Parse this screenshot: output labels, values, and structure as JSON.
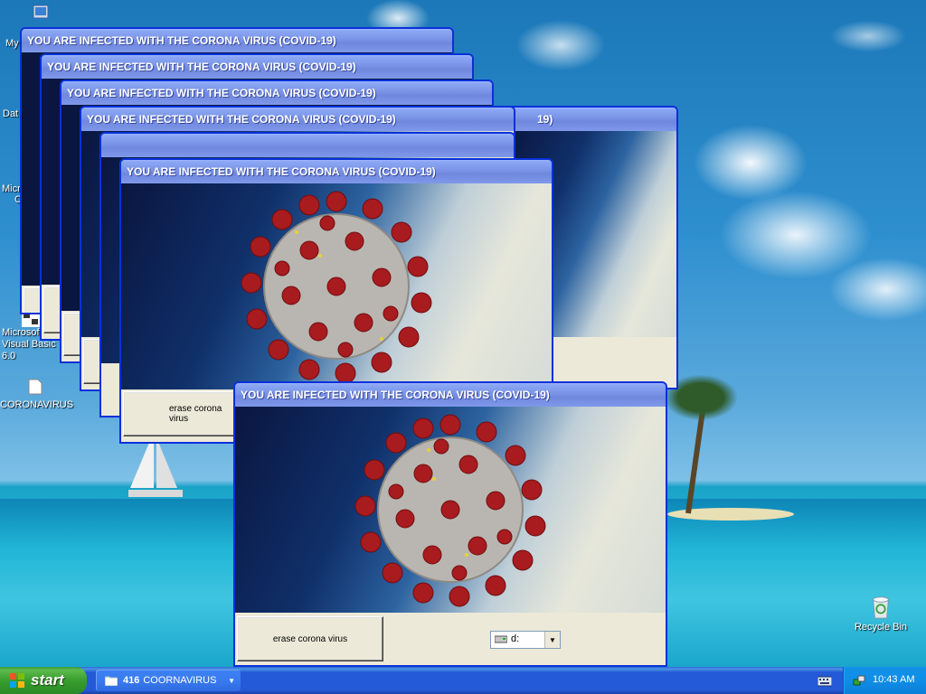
{
  "desktop": {
    "icons": [
      {
        "label": "My"
      },
      {
        "label": "Dat"
      },
      {
        "label": "Micros"
      },
      {
        "label": "C"
      },
      {
        "label": "Microsoft Visual Basic 6.0"
      },
      {
        "label": "CORONAVIRUS"
      },
      {
        "label": "Recycle Bin"
      }
    ]
  },
  "windows": {
    "title": "YOU ARE INFECTED WITH THE CORONA VIRUS (COVID-19)",
    "erase_button": "erase corona virus",
    "erase_button_partial": "e",
    "drive_value": "d:",
    "drive_icon": "drive-icon"
  },
  "taskbar": {
    "start_label": "start",
    "task_group_count": "416",
    "task_group_label": "COORNAVIRUS",
    "clock": "10:43 AM"
  },
  "colors": {
    "title_bar": "#7c96e8",
    "window_frame": "#0831d9",
    "taskbar": "#245ad7",
    "start_button": "#379e2e"
  }
}
